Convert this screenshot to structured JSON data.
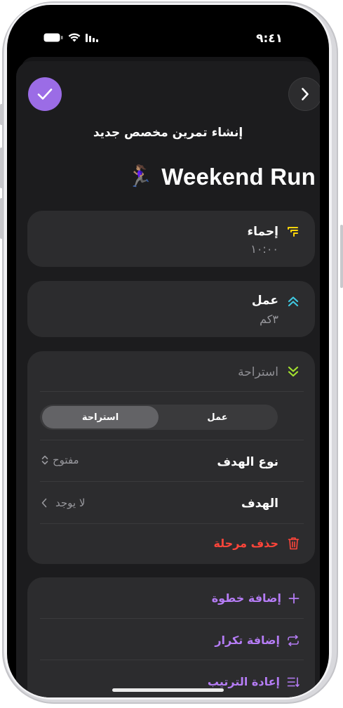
{
  "status_bar": {
    "time": "٩:٤١"
  },
  "header": {
    "confirm_icon": "checkmark-icon",
    "forward_icon": "chevron-right-icon",
    "subtitle": "إنشاء تمرين مخصص جديد",
    "workout_title": "Weekend Run",
    "workout_emoji": "🏃🏽‍♀️"
  },
  "steps": [
    {
      "title": "إحماء",
      "value": "١٠:٠٠",
      "icon": "warmup-icon",
      "color": "#ffd60a"
    },
    {
      "title": "عمل",
      "value": "٣كم",
      "icon": "double-chevron-up-icon",
      "color": "#40c8e0"
    },
    {
      "title": "استراحة",
      "icon": "double-chevron-down-icon",
      "color": "#a4e22f"
    }
  ],
  "editor": {
    "segment_rest": "استراحة",
    "segment_work": "عمل",
    "goal_type_label": "نوع الهدف",
    "goal_type_value": "مفتوح",
    "goal_label": "الهدف",
    "goal_value": "لا يوجد",
    "delete_label": "حذف مرحلة"
  },
  "actions": [
    {
      "label": "إضافة خطوة",
      "icon": "plus-icon"
    },
    {
      "label": "إضافة تكرار",
      "icon": "repeat-icon"
    },
    {
      "label": "إعادة الترتيب",
      "icon": "reorder-icon"
    }
  ],
  "colors": {
    "accent": "#9b6ce6",
    "danger": "#ff453a",
    "action": "#b57cf5"
  }
}
